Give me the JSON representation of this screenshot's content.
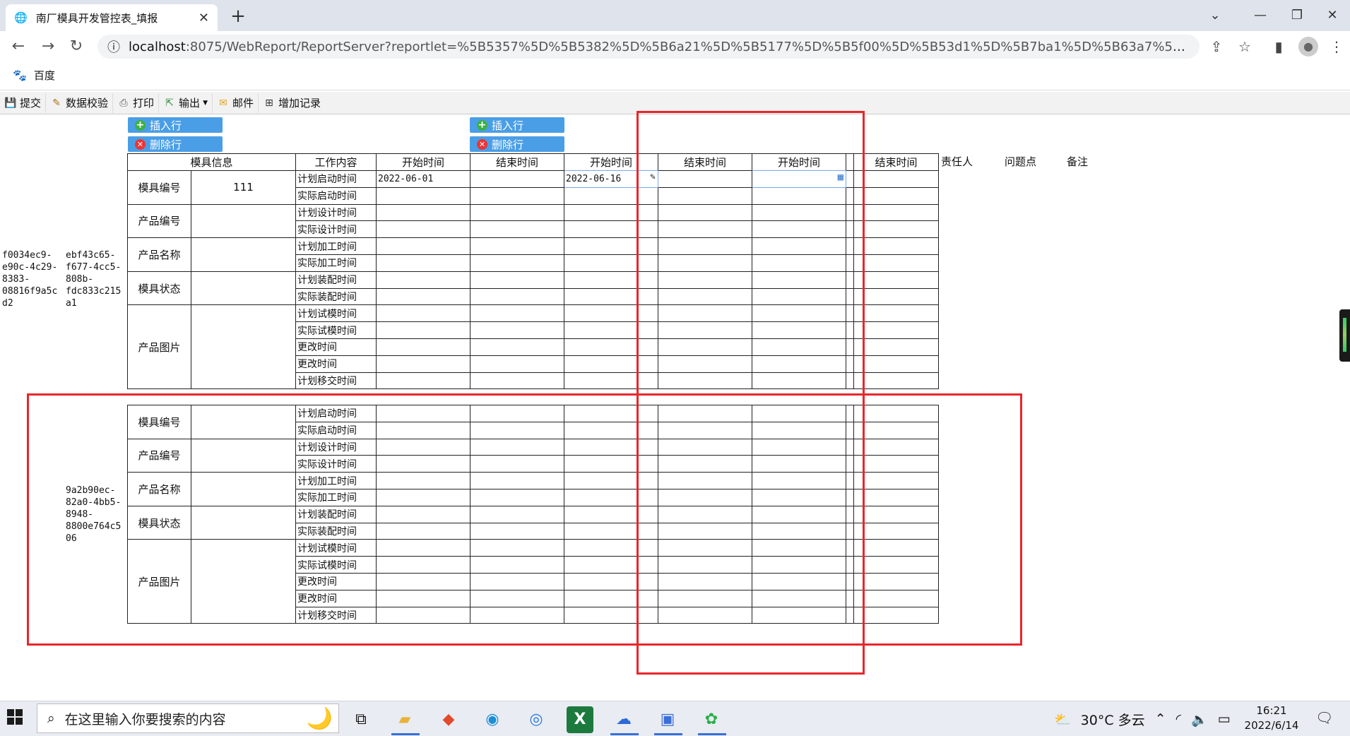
{
  "browser": {
    "tab_title": "南厂模具开发管控表_填报",
    "url_host": "localhost",
    "url_rest": ":8075/WebReport/ReportServer?reportlet=%5B5357%5D%5B5382%5D%5B6a21%5D%5B5177%5D%5B5f00%5D%5B53d1%5D%5B7ba1%5D%5B63a7%5D%5B8868%5D_...",
    "bookmark": "百度"
  },
  "toolbar": {
    "submit": "提交",
    "validate": "数据校验",
    "print": "打印",
    "export": "输出",
    "mail": "邮件",
    "add_record": "增加记录"
  },
  "buttons": {
    "insert_row": "插入行",
    "delete_row": "删除行"
  },
  "headers": {
    "mold_info": "模具信息",
    "work_content": "工作内容",
    "start1": "开始时间",
    "end1": "结束时间",
    "start2": "开始时间",
    "end2": "结束时间",
    "start3": "开始时间",
    "end3": "结束时间",
    "owner": "责任人",
    "issue": "问题点",
    "remark": "备注"
  },
  "labels": {
    "mold_no": "模具编号",
    "product_no": "产品编号",
    "product_name": "产品名称",
    "mold_status": "模具状态",
    "product_image": "产品图片"
  },
  "tasks": [
    "计划启动时间",
    "实际启动时间",
    "计划设计时间",
    "实际设计时间",
    "计划加工时间",
    "实际加工时间",
    "计划装配时间",
    "实际装配时间",
    "计划试模时间",
    "实际试模时间",
    "更改时间",
    "更改时间",
    "计划移交时间"
  ],
  "record1": {
    "uuid_a": [
      "f0034ec9-",
      "e90c-4c29-",
      "8383-",
      "08816f9a5c",
      "d2"
    ],
    "uuid_b": [
      "ebf43c65-",
      "f677-4cc5-",
      "808b-",
      "fdc833c215",
      "a1"
    ],
    "mold_no": "111",
    "start1_row0": "2022-06-01",
    "start2_row0": "2022-06-16"
  },
  "record2": {
    "uuid": [
      "9a2b90ec-",
      "82a0-4bb5-",
      "8948-",
      "8800e764c5",
      "06"
    ]
  },
  "taskbar": {
    "search_placeholder": "在这里输入你要搜索的内容",
    "weather": "30°C  多云",
    "time": "16:21",
    "date": "2022/6/14"
  },
  "colors": {
    "annotation_red": "#e8262b",
    "button_blue": "#4a9ee6"
  }
}
